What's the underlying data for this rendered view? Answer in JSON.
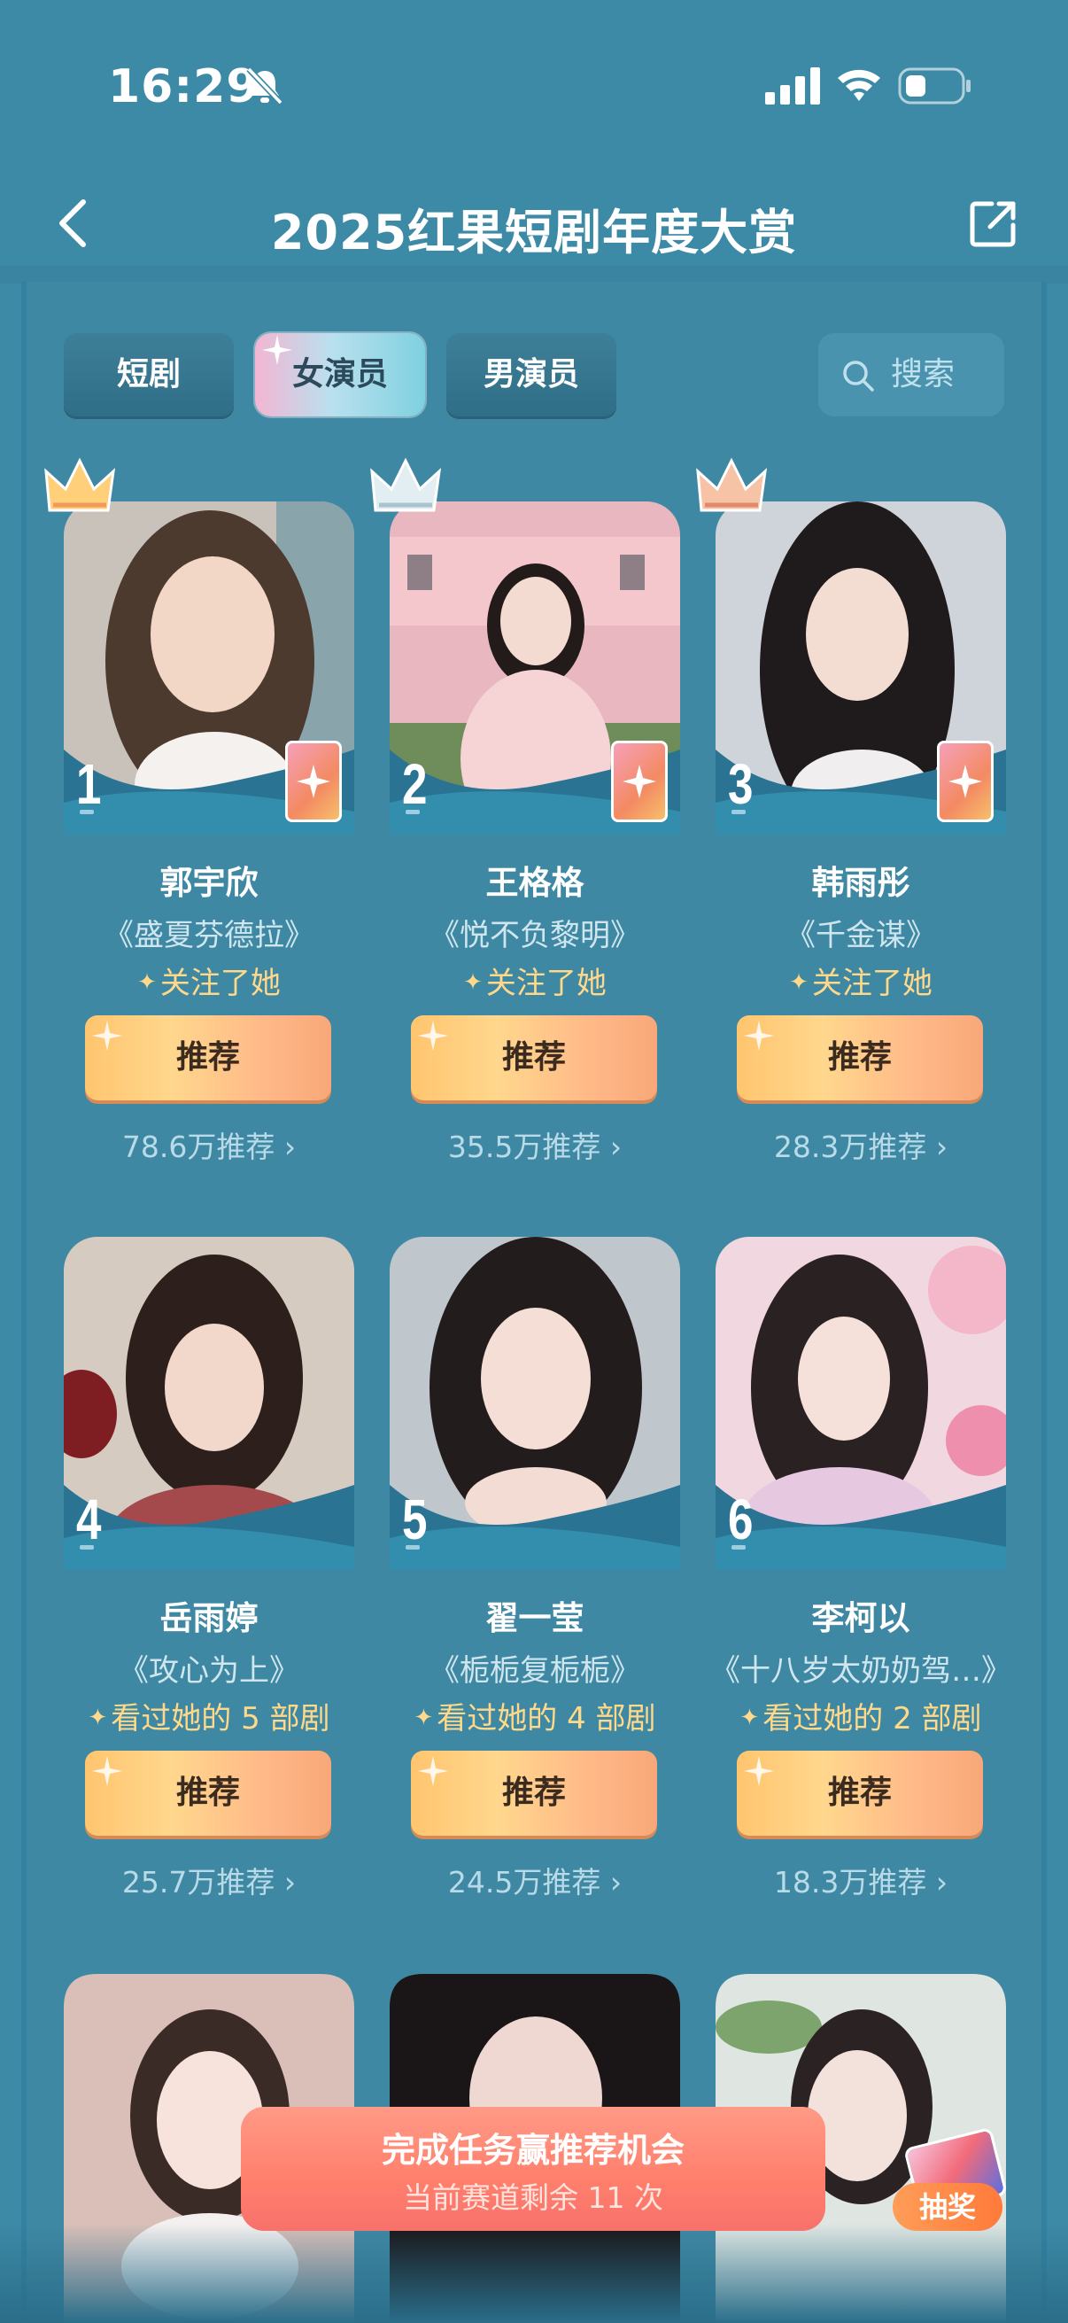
{
  "status_bar": {
    "time": "16:29"
  },
  "header": {
    "title": "2025红果短剧年度大赏"
  },
  "tabs": [
    {
      "label": "短剧",
      "active": false
    },
    {
      "label": "女演员",
      "active": true
    },
    {
      "label": "男演员",
      "active": false
    }
  ],
  "search": {
    "label": "搜索"
  },
  "actresses": [
    {
      "rank": "1",
      "name": "郭宇欣",
      "drama": "《盛夏芬德拉》",
      "note": "关注了她",
      "button": "推荐",
      "count": "78.6万推荐 ›",
      "crown": "gold"
    },
    {
      "rank": "2",
      "name": "王格格",
      "drama": "《悦不负黎明》",
      "note": "关注了她",
      "button": "推荐",
      "count": "35.5万推荐 ›",
      "crown": "silver"
    },
    {
      "rank": "3",
      "name": "韩雨彤",
      "drama": "《千金谋》",
      "note": "关注了她",
      "button": "推荐",
      "count": "28.3万推荐 ›",
      "crown": "bronze"
    },
    {
      "rank": "4",
      "name": "岳雨婷",
      "drama": "《攻心为上》",
      "note": "看过她的 5 部剧",
      "button": "推荐",
      "count": "25.7万推荐 ›"
    },
    {
      "rank": "5",
      "name": "翟一莹",
      "drama": "《栀栀复栀栀》",
      "note": "看过她的 4 部剧",
      "button": "推荐",
      "count": "24.5万推荐 ›"
    },
    {
      "rank": "6",
      "name": "李柯以",
      "drama": "《十八岁太奶奶驾…》",
      "note": "看过她的 2 部剧",
      "button": "推荐",
      "count": "18.3万推荐 ›"
    }
  ],
  "task_banner": {
    "title": "完成任务赢推荐机会",
    "subtitle": "当前赛道剩余 11 次"
  },
  "lottery": {
    "label": "抽奖"
  },
  "colors": {
    "accent_gold": "#ffd98a",
    "background": "#3d8aa6",
    "button": "#ffc56f",
    "banner": "#ff7f6c"
  }
}
